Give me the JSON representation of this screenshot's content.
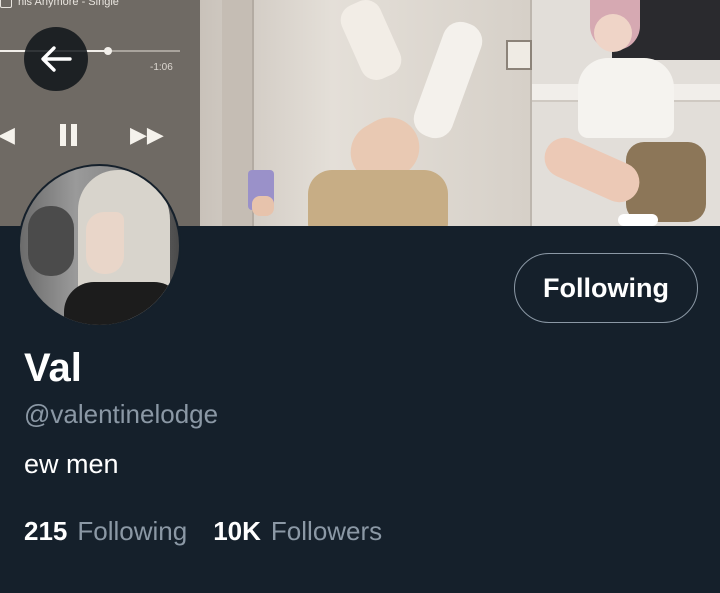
{
  "banner": {
    "music_player": {
      "song_text": "his Anymore - Single",
      "time_remaining": "-1:06",
      "progress": 0.6
    }
  },
  "header": {
    "back_icon": "arrow-left-icon"
  },
  "profile": {
    "follow_button_label": "Following",
    "display_name": "Val",
    "handle": "@valentinelodge",
    "bio": "ew men",
    "stats": {
      "following_count": "215",
      "following_label": "Following",
      "followers_count": "10K",
      "followers_label": "Followers"
    }
  },
  "colors": {
    "background": "#15202b",
    "secondary_text": "#8b98a5",
    "primary_text": "#ffffff"
  }
}
